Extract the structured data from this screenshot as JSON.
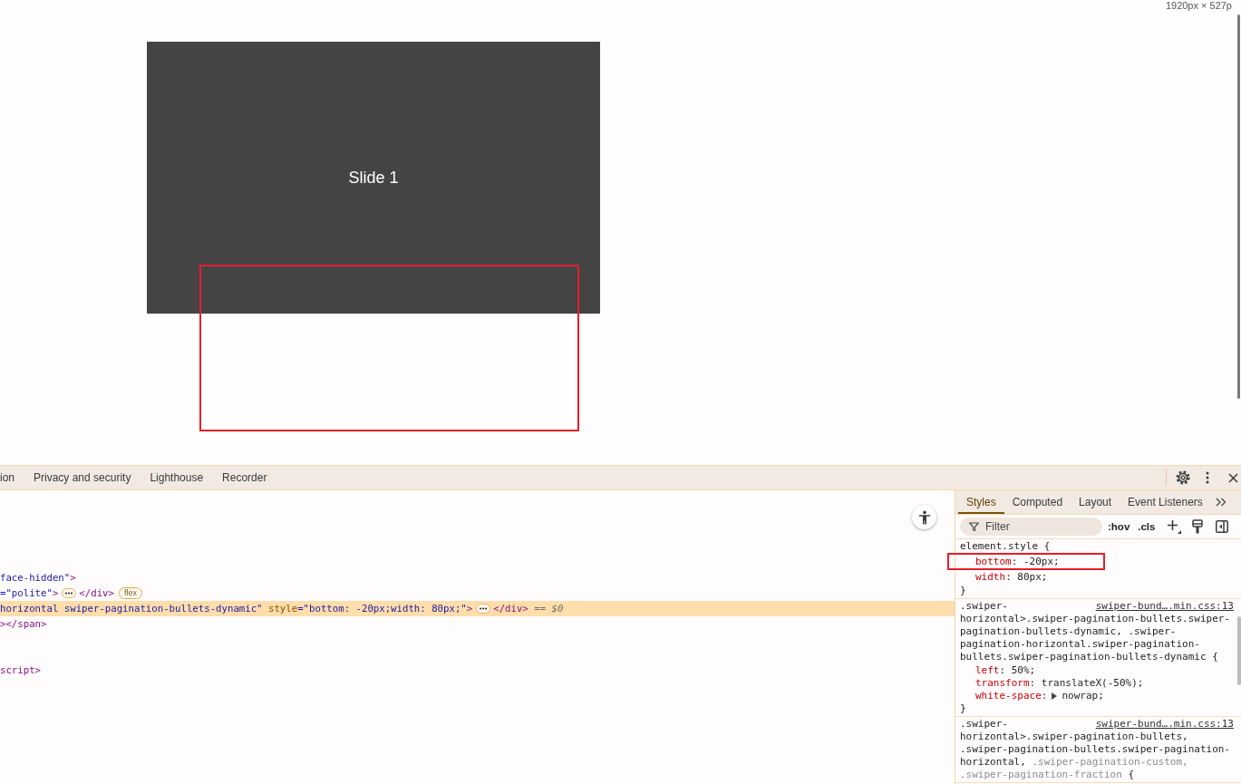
{
  "viewport": {
    "size_label": "1920px × 527p",
    "slide": {
      "title": "Slide 1"
    }
  },
  "devtools": {
    "tabs": [
      {
        "label": "ion",
        "selected": false
      },
      {
        "label": "Privacy and security",
        "selected": false
      },
      {
        "label": "Lighthouse",
        "selected": false
      },
      {
        "label": "Recorder",
        "selected": false
      }
    ],
    "elements": {
      "groups": [
        {
          "lines": [
            {
              "selected": false,
              "segments": [
                {
                  "kind": "code",
                  "tokens": [
                    {
                      "kind": "value",
                      "text": "face-hidden\""
                    },
                    {
                      "kind": "tag",
                      "text": ">"
                    }
                  ]
                }
              ]
            },
            {
              "selected": false,
              "segments": [
                {
                  "kind": "code",
                  "tokens": [
                    {
                      "kind": "value",
                      "text": "=\"polite\""
                    },
                    {
                      "kind": "tag",
                      "text": ">"
                    }
                  ]
                },
                {
                  "kind": "more"
                },
                {
                  "kind": "code",
                  "tokens": [
                    {
                      "kind": "tag",
                      "text": "</div>"
                    }
                  ]
                },
                {
                  "kind": "badge",
                  "text": "flex"
                }
              ]
            },
            {
              "selected": true,
              "segments": [
                {
                  "kind": "code",
                  "tokens": [
                    {
                      "kind": "value",
                      "text": "horizontal swiper-pagination-bullets-dynamic\""
                    },
                    {
                      "kind": "attr",
                      "text": " style"
                    },
                    {
                      "kind": "value",
                      "text": "=\"bottom: -20px;width: 80px;\""
                    },
                    {
                      "kind": "tag",
                      "text": ">"
                    }
                  ]
                },
                {
                  "kind": "more"
                },
                {
                  "kind": "code",
                  "tokens": [
                    {
                      "kind": "tag",
                      "text": "</div>"
                    },
                    {
                      "kind": "note",
                      "text": " == $0"
                    }
                  ]
                }
              ]
            },
            {
              "selected": false,
              "segments": [
                {
                  "kind": "code",
                  "tokens": [
                    {
                      "kind": "tag",
                      "text": "></span>"
                    }
                  ]
                }
              ]
            }
          ]
        },
        {
          "lines": [
            {
              "selected": false,
              "segments": [
                {
                  "kind": "code",
                  "tokens": [
                    {
                      "kind": "tag",
                      "text": "script>"
                    }
                  ]
                }
              ]
            }
          ]
        }
      ]
    },
    "styles": {
      "tabs": [
        {
          "label": "Styles",
          "selected": true
        },
        {
          "label": "Computed",
          "selected": false
        },
        {
          "label": "Layout",
          "selected": false
        },
        {
          "label": "Event Listeners",
          "selected": false
        }
      ],
      "filter": {
        "placeholder": "Filter"
      },
      "toggles": [
        ":hov",
        ".cls"
      ],
      "rules": [
        {
          "selector_lines": [
            [
              {
                "kind": "selector",
                "text": "element.style {"
              }
            ]
          ],
          "declarations": [
            [
              {
                "kind": "code",
                "tokens": [
                  {
                    "kind": "property",
                    "text": "bottom"
                  },
                  {
                    "kind": "plain",
                    "text": ": -20px;"
                  }
                ]
              }
            ],
            [
              {
                "kind": "code",
                "tokens": [
                  {
                    "kind": "property",
                    "text": "width"
                  },
                  {
                    "kind": "plain",
                    "text": ": 80px;"
                  }
                ]
              }
            ]
          ],
          "close": "}"
        },
        {
          "source": "swiper-bund….min.css:13",
          "selector_lines": [
            [
              {
                "kind": "selector",
                "text": ".swiper-"
              }
            ],
            [
              {
                "kind": "selector",
                "text": "horizontal>.swiper-pagination-bullets.swiper-"
              }
            ],
            [
              {
                "kind": "selector",
                "text": "pagination-bullets-dynamic, .swiper-"
              }
            ],
            [
              {
                "kind": "selector",
                "text": "pagination-horizontal.swiper-pagination-"
              }
            ],
            [
              {
                "kind": "selector",
                "text": "bullets.swiper-pagination-bullets-dynamic {"
              }
            ]
          ],
          "declarations": [
            [
              {
                "kind": "code",
                "tokens": [
                  {
                    "kind": "property",
                    "text": "left"
                  },
                  {
                    "kind": "plain",
                    "text": ": 50%;"
                  }
                ]
              }
            ],
            [
              {
                "kind": "code",
                "tokens": [
                  {
                    "kind": "property",
                    "text": "transform"
                  },
                  {
                    "kind": "plain",
                    "text": ": translateX(-50%);"
                  }
                ]
              }
            ],
            [
              {
                "kind": "code",
                "tokens": [
                  {
                    "kind": "property",
                    "text": "white-space"
                  },
                  {
                    "kind": "plain",
                    "text": ":"
                  }
                ]
              },
              {
                "kind": "toggle"
              },
              {
                "kind": "code",
                "tokens": [
                  {
                    "kind": "plain",
                    "text": "nowrap;"
                  }
                ]
              }
            ]
          ],
          "close": "}"
        },
        {
          "source": "swiper-bund….min.css:13",
          "selector_lines": [
            [
              {
                "kind": "selector",
                "text": ".swiper-"
              }
            ],
            [
              {
                "kind": "selector",
                "text": "horizontal>.swiper-pagination-bullets,"
              }
            ],
            [
              {
                "kind": "selector",
                "text": ".swiper-pagination-bullets.swiper-pagination-"
              }
            ],
            [
              {
                "kind": "selector",
                "text": "horizontal,"
              },
              {
                "kind": "unmatched",
                "text": " .swiper-pagination-custom,"
              }
            ],
            [
              {
                "kind": "unmatched",
                "text": ".swiper-pagination-fraction"
              },
              {
                "kind": "selector",
                "text": " {"
              }
            ]
          ]
        }
      ]
    }
  }
}
